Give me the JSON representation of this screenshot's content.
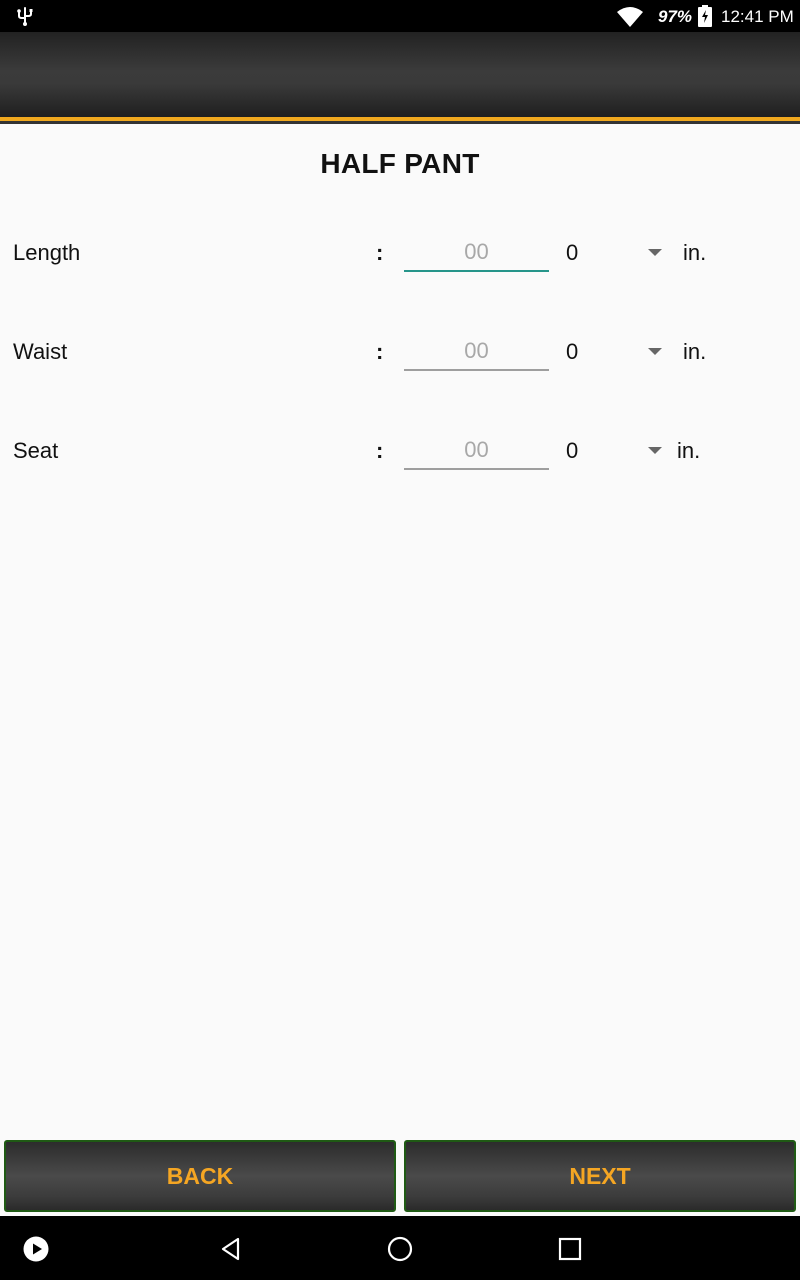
{
  "status_bar": {
    "battery_percent": "97%",
    "time": "12:41 PM",
    "icons": [
      "usb-icon",
      "wifi-icon",
      "battery-charging-icon"
    ]
  },
  "page": {
    "title": "HALF PANT"
  },
  "measurements": [
    {
      "label": "Length",
      "separator": ":",
      "inches_placeholder": "00",
      "inches_value": "",
      "fraction": "0",
      "unit": "in.",
      "focused": true
    },
    {
      "label": "Waist",
      "separator": ":",
      "inches_placeholder": "00",
      "inches_value": "",
      "fraction": "0",
      "unit": "in.",
      "focused": false
    },
    {
      "label": "Seat",
      "separator": ":",
      "inches_placeholder": "00",
      "inches_value": "",
      "fraction": "0",
      "unit": "in.",
      "focused": false
    }
  ],
  "buttons": {
    "back_label": "BACK",
    "next_label": "NEXT"
  },
  "nav_bar": {
    "icons": [
      "play-icon",
      "back-triangle-icon",
      "home-circle-icon",
      "recents-square-icon"
    ]
  },
  "colors": {
    "accent": "#f0a81e",
    "button_text": "#f5a623",
    "focus_underline": "#26958a",
    "button_border": "#1f5a14"
  }
}
